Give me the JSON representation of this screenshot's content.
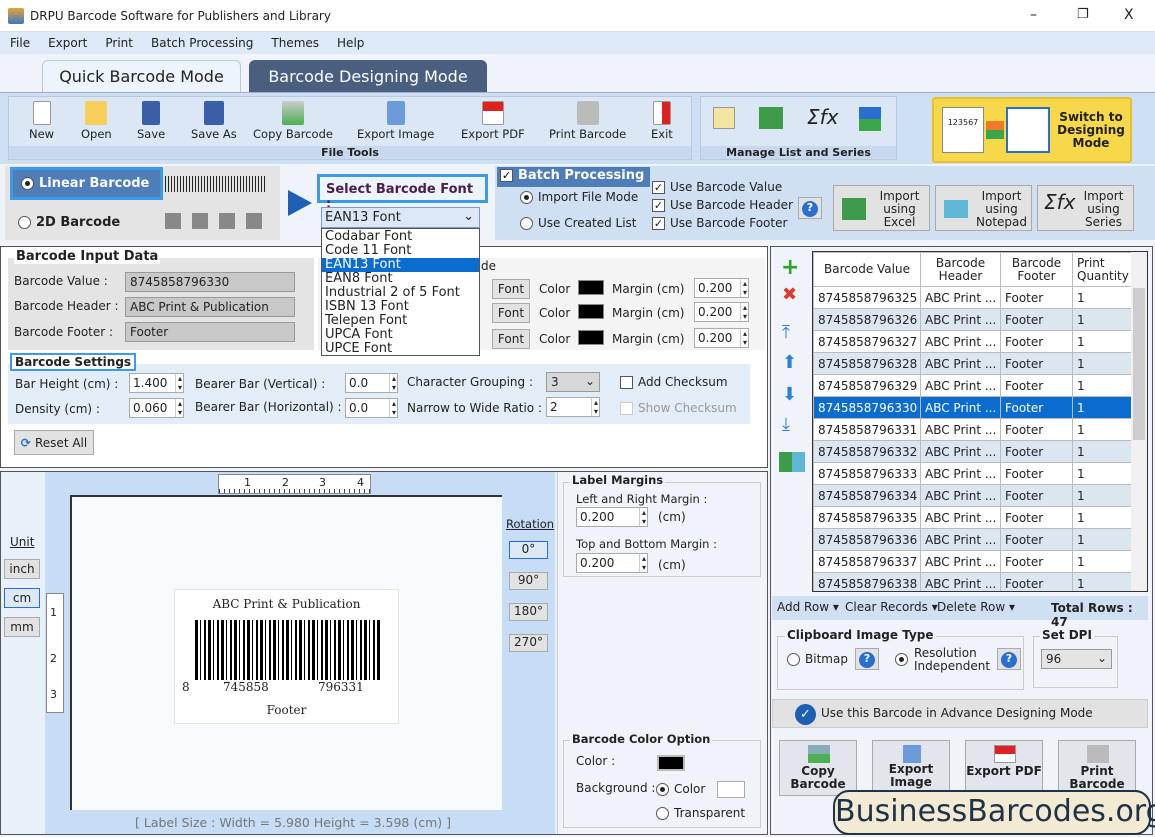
{
  "window": {
    "title": "DRPU Barcode Software for Publishers and Library",
    "minimize": "–",
    "restore": "❐",
    "close": "X"
  },
  "menu": [
    "File",
    "Export",
    "Print",
    "Batch Processing",
    "Themes",
    "Help"
  ],
  "tabs": {
    "quick": "Quick Barcode Mode",
    "designing": "Barcode Designing Mode"
  },
  "file_tools": {
    "label": "File Tools",
    "items": [
      "New",
      "Open",
      "Save",
      "Save As",
      "Copy Barcode",
      "Export Image",
      "Export PDF",
      "Print Barcode",
      "Exit"
    ]
  },
  "manage": {
    "label": "Manage List and Series",
    "sigma": "Σfx"
  },
  "switch": {
    "label": "Switch to Designing Mode",
    "sample": "123567"
  },
  "barcode_type": {
    "linear": "Linear Barcode",
    "twod": "2D Barcode",
    "selected": "linear"
  },
  "font_select": {
    "label": "Select Barcode Font :",
    "value": "EAN13 Font",
    "options": [
      "Codabar Font",
      "Code 11 Font",
      "EAN13 Font",
      "EAN8 Font",
      "Industrial 2 of 5 Font",
      "ISBN 13 Font",
      "Telepen Font",
      "UPCA Font",
      "UPCE Font"
    ]
  },
  "batch": {
    "title": "Batch Processing",
    "checked": true,
    "import_file": "Import File Mode",
    "use_created": "Use Created List",
    "use_value": "Use Barcode Value",
    "use_header": "Use Barcode Header",
    "use_footer": "Use Barcode Footer",
    "help": "?"
  },
  "imports": [
    {
      "label": "Import using Excel"
    },
    {
      "label": "Import using Notepad"
    },
    {
      "label": "Import using Series"
    }
  ],
  "input_data": {
    "title": "Barcode Input Data",
    "value_label": "Barcode Value :",
    "value": "8745858796330",
    "header_label": "Barcode Header :",
    "header": "ABC Print & Publication",
    "footer_label": "Barcode Footer :",
    "footer": "Footer",
    "partial_label": "de",
    "rows": [
      {
        "font": "Font",
        "color": "Color",
        "margin_label": "Margin (cm)",
        "margin": "0.200"
      },
      {
        "font": "Font",
        "color": "Color",
        "margin_label": "Margin (cm)",
        "margin": "0.200"
      },
      {
        "font": "Font",
        "color": "Color",
        "margin_label": "Margin (cm)",
        "margin": "0.200"
      }
    ]
  },
  "settings": {
    "title": "Barcode Settings",
    "bar_height_label": "Bar Height (cm) :",
    "bar_height": "1.400",
    "density_label": "Density (cm) :",
    "density": "0.060",
    "bearer_v_label": "Bearer Bar (Vertical) :",
    "bearer_v": "0.0",
    "bearer_h_label": "Bearer Bar (Horizontal) :",
    "bearer_h": "0.0",
    "char_group_label": "Character Grouping :",
    "char_group": "3",
    "ratio_label": "Narrow to Wide Ratio :",
    "ratio": "2",
    "add_checksum": "Add Checksum",
    "show_checksum": "Show Checksum",
    "reset": "Reset All"
  },
  "units": {
    "label": "Unit",
    "options": [
      "inch",
      "cm",
      "mm"
    ],
    "selected": "cm"
  },
  "ruler": {
    "h": [
      "1",
      "2",
      "3",
      "4"
    ],
    "v": [
      "1",
      "2",
      "3"
    ]
  },
  "preview": {
    "header": "ABC Print & Publication",
    "digits": [
      "8",
      "745858",
      "796331"
    ],
    "footer": "Footer",
    "size": "[ Label Size : Width = 5.980  Height = 3.598 (cm) ]"
  },
  "rotation": {
    "label": "Rotation",
    "options": [
      "0°",
      "90°",
      "180°",
      "270°"
    ],
    "selected": "0°"
  },
  "label_margins": {
    "title": "Label Margins",
    "lr_label": "Left and Right Margin :",
    "lr": "0.200",
    "tb_label": "Top and Bottom Margin :",
    "tb": "0.200",
    "unit": "(cm)"
  },
  "color_option": {
    "title": "Barcode Color Option",
    "color_label": "Color :",
    "bg_label": "Background :",
    "bg_color": "Color",
    "bg_transparent": "Transparent",
    "barcode_color": "#000000",
    "bg_value": "#ffffff"
  },
  "grid": {
    "columns": [
      "Barcode Value",
      "Barcode Header",
      "Barcode Footer",
      "Print Quantity"
    ],
    "rows": [
      [
        "8745858796325",
        "ABC Print ...",
        "Footer",
        "1"
      ],
      [
        "8745858796326",
        "ABC Print ...",
        "Footer",
        "1"
      ],
      [
        "8745858796327",
        "ABC Print ...",
        "Footer",
        "1"
      ],
      [
        "8745858796328",
        "ABC Print ...",
        "Footer",
        "1"
      ],
      [
        "8745858796329",
        "ABC Print ...",
        "Footer",
        "1"
      ],
      [
        "8745858796330",
        "ABC Print ...",
        "Footer",
        "1"
      ],
      [
        "8745858796331",
        "ABC Print ...",
        "Footer",
        "1"
      ],
      [
        "8745858796332",
        "ABC Print ...",
        "Footer",
        "1"
      ],
      [
        "8745858796333",
        "ABC Print ...",
        "Footer",
        "1"
      ],
      [
        "8745858796334",
        "ABC Print ...",
        "Footer",
        "1"
      ],
      [
        "8745858796335",
        "ABC Print ...",
        "Footer",
        "1"
      ],
      [
        "8745858796336",
        "ABC Print ...",
        "Footer",
        "1"
      ],
      [
        "8745858796337",
        "ABC Print ...",
        "Footer",
        "1"
      ],
      [
        "8745858796338",
        "ABC Print ...",
        "Footer",
        "1"
      ]
    ],
    "selected_row": 5,
    "add_row": "Add Row ▾",
    "clear": "Clear Records ▾",
    "delete": "Delete Row ▾",
    "total": "Total Rows : 47"
  },
  "clipboard": {
    "title": "Clipboard Image Type",
    "bitmap": "Bitmap",
    "resolution": "Resolution Independent",
    "selected": "resolution"
  },
  "dpi": {
    "title": "Set DPI",
    "value": "96"
  },
  "advance": "Use this Barcode in Advance Designing Mode",
  "actions": [
    "Copy Barcode",
    "Export Image",
    "Export PDF",
    "Print Barcode"
  ],
  "watermark": "BusinessBarcodes.org",
  "colors": {
    "accent": "#0a6ccf",
    "panel": "#dbe7f5",
    "tab_dark": "#4a5e80",
    "switch": "#f7d84a"
  }
}
